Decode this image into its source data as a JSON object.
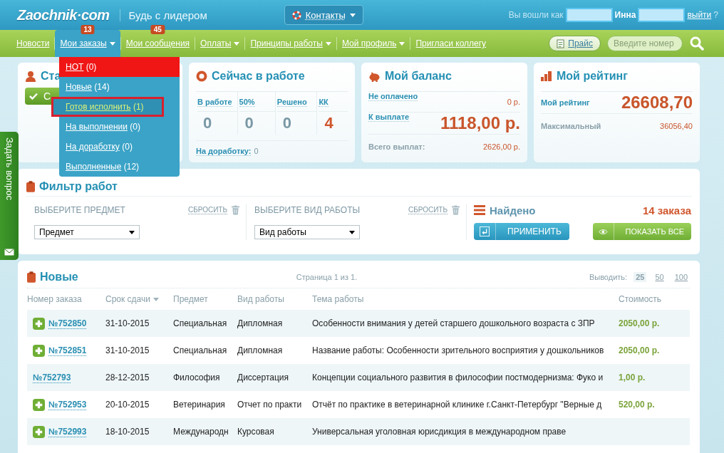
{
  "header": {
    "logo": "Zaochnik·com",
    "slogan": "Будь с лидером",
    "contacts": "Контакты",
    "login_prefix": "Вы вошли как",
    "user_name": "Инна",
    "logout": "выйти",
    "logout_suffix": "?"
  },
  "nav": {
    "items": [
      {
        "label": "Новости",
        "caret": false,
        "selected": false
      },
      {
        "label": "Мои заказы",
        "caret": true,
        "selected": true,
        "badge": "13"
      },
      {
        "label": "Мои сообщения",
        "caret": false,
        "selected": false,
        "badge": "45"
      },
      {
        "label": "Оплаты",
        "caret": true,
        "selected": false
      },
      {
        "label": "Принципы работы",
        "caret": true,
        "selected": false
      },
      {
        "label": "Мой профиль",
        "caret": true,
        "selected": false
      },
      {
        "label": "Пригласи коллегу",
        "caret": false,
        "selected": false
      }
    ],
    "price_button": "Прайс",
    "search": {
      "placeholder": "Введите номер"
    }
  },
  "orders_menu": [
    {
      "label": "НОТ",
      "count": "(0)",
      "kind": "hot",
      "selected": false
    },
    {
      "label": "Новые",
      "count": "(14)",
      "kind": "normal",
      "selected": false
    },
    {
      "label": "Готов исполнить",
      "count": "(1)",
      "kind": "normal",
      "selected": true
    },
    {
      "label": "На выполнении",
      "count": "(0)",
      "kind": "normal",
      "selected": false
    },
    {
      "label": "На доработку",
      "count": "(0)",
      "kind": "normal",
      "selected": false
    },
    {
      "label": "Выполненные",
      "count": "(12)",
      "kind": "normal",
      "selected": false
    }
  ],
  "side_tab": "Задать вопрос",
  "status_card": {
    "title": "Ста",
    "button": "С"
  },
  "work_card": {
    "title": "Сейчас в работе",
    "columns": [
      {
        "label": "В работе",
        "value": "0",
        "highlight": false
      },
      {
        "label": "50%",
        "value": "0",
        "highlight": false
      },
      {
        "label": "Решено",
        "value": "0",
        "highlight": false
      },
      {
        "label": "КК",
        "value": "4",
        "highlight": true
      }
    ],
    "footer_label": "На доработку:",
    "footer_value": "0"
  },
  "balance_card": {
    "title": "Мой баланс",
    "rows": [
      {
        "label": "Не оплачено",
        "value": "0 р.",
        "kind": "link"
      },
      {
        "label": "К выплате",
        "value": "1118,00 р.",
        "kind": "big"
      },
      {
        "label": "Всего выплат:",
        "value": "2626,00 р.",
        "kind": "total"
      }
    ]
  },
  "rating_card": {
    "title": "Мой рейтинг",
    "rows": [
      {
        "label": "Мой рейтинг",
        "value": "26608,70",
        "kind": "big"
      },
      {
        "label": "Максимальный",
        "value": "36056,40",
        "kind": "total"
      }
    ]
  },
  "filter": {
    "title": "Фильтр работ",
    "groups": [
      {
        "label": "ВЫБЕРИТЕ ПРЕДМЕТ",
        "reset": "СБРОСИТЬ",
        "select": "Предмет"
      },
      {
        "label": "ВЫБЕРИТЕ ВИД РАБОТЫ",
        "reset": "СБРОСИТЬ",
        "select": "Вид работы"
      }
    ],
    "found_label": "Найдено",
    "found_value": "14 заказа",
    "apply": "ПРИМЕНИТЬ",
    "show_all": "ПОКАЗАТЬ ВСЕ"
  },
  "orders": {
    "title": "Новые",
    "page_info": "Страница 1 из 1.",
    "per_page_label": "Выводить:",
    "per_page": [
      {
        "label": "25",
        "selected": true
      },
      {
        "label": "50",
        "selected": false
      },
      {
        "label": "100",
        "selected": false
      }
    ],
    "columns": [
      {
        "label": "Номер заказа",
        "sorted": false
      },
      {
        "label": "Срок сдачи",
        "sorted": true
      },
      {
        "label": "Предмет",
        "sorted": false
      },
      {
        "label": "Вид работы",
        "sorted": false
      },
      {
        "label": "Тема работы",
        "sorted": false
      },
      {
        "label": "Стоимость",
        "sorted": false
      }
    ],
    "rows": [
      {
        "addable": true,
        "number": "№752850",
        "deadline": "31-10-2015",
        "subject": "Специальная",
        "type": "Дипломная",
        "topic": "Особенности внимания у детей старшего дошкольного возраста с ЗПР",
        "price": "2050,00 р."
      },
      {
        "addable": true,
        "number": "№752851",
        "deadline": "31-10-2015",
        "subject": "Специальная",
        "type": "Дипломная",
        "topic": "Название работы: Особенности зрительного восприятия у дошкольников",
        "price": "2050,00 р."
      },
      {
        "addable": false,
        "number": "№752793",
        "deadline": "28-12-2015",
        "subject": "Философия",
        "type": "Диссертация",
        "topic": "Концепции социального развития в философии постмодернизма: Фуко и",
        "price": "1,00 р."
      },
      {
        "addable": true,
        "number": "№752953",
        "deadline": "20-10-2015",
        "subject": "Ветеринария",
        "type": "Отчет по практи",
        "topic": "Отчёт по практике в ветеринарной клинике г.Санкт-Петербург \"Верные д",
        "price": "520,00 р."
      },
      {
        "addable": true,
        "number": "№752993",
        "deadline": "18-10-2015",
        "subject": "Международн",
        "type": "Курсовая",
        "topic": "Универсальная уголовная юрисдикция в международном праве"
      }
    ]
  }
}
